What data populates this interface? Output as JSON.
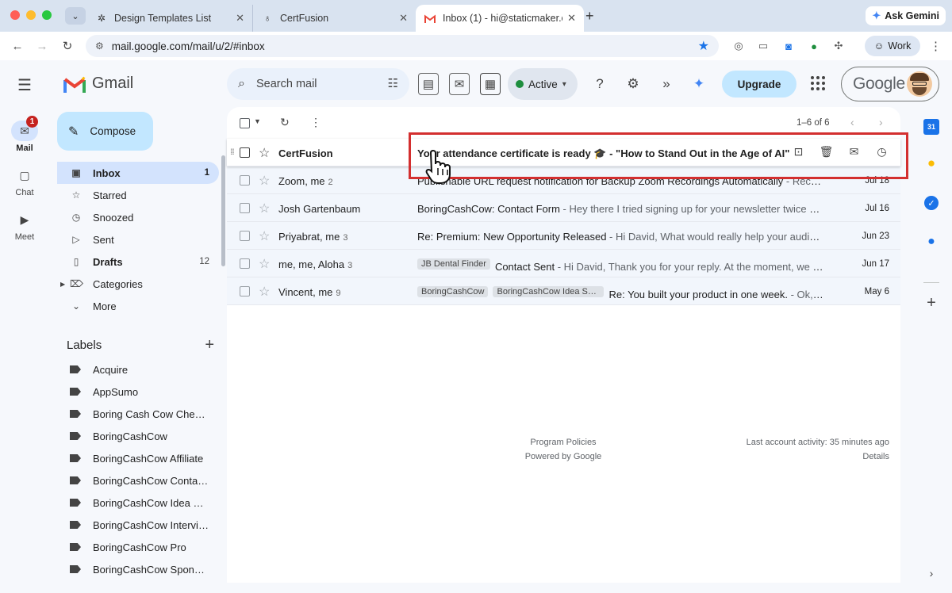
{
  "browser": {
    "tabs": [
      {
        "title": "Design Templates List",
        "icon": "openai-icon"
      },
      {
        "title": "CertFusion",
        "icon": "certfusion-icon"
      },
      {
        "title": "Inbox (1) - hi@staticmaker.co",
        "icon": "gmail-icon"
      }
    ],
    "ask_gemini": "Ask Gemini",
    "url": "mail.google.com/mail/u/2/#inbox",
    "profile": "Work"
  },
  "gmail": {
    "brand": "Gmail",
    "rail": {
      "mail": "Mail",
      "mail_badge": "1",
      "chat": "Chat",
      "meet": "Meet"
    },
    "compose": "Compose",
    "search_placeholder": "Search mail",
    "status": "Active",
    "upgrade": "Upgrade",
    "account_brand": "Google",
    "folders": [
      {
        "label": "Inbox",
        "count": "1",
        "icon": "inbox-icon"
      },
      {
        "label": "Starred",
        "count": "",
        "icon": "star-icon"
      },
      {
        "label": "Snoozed",
        "count": "",
        "icon": "clock-icon"
      },
      {
        "label": "Sent",
        "count": "",
        "icon": "send-icon"
      },
      {
        "label": "Drafts",
        "count": "12",
        "icon": "draft-icon"
      },
      {
        "label": "Categories",
        "count": "",
        "icon": "label-icon"
      },
      {
        "label": "More",
        "count": "",
        "icon": "chevron-down-icon"
      }
    ],
    "labels_heading": "Labels",
    "labels": [
      "Acquire",
      "AppSumo",
      "Boring Cash Cow Check...",
      "BoringCashCow",
      "BoringCashCow Affiliate",
      "BoringCashCow Contact...",
      "BoringCashCow Idea Su...",
      "BoringCashCow Interview",
      "BoringCashCow Pro",
      "BoringCashCow Sponso..."
    ],
    "page_count": "1–6 of 6",
    "emails": [
      {
        "sender": "CertFusion",
        "count": "",
        "chips": [],
        "subject": "Your attendance certificate is ready 🎓 - \"How to Stand Out in the Age of AI\"",
        "snippet": "",
        "date": ""
      },
      {
        "sender": "Zoom, me",
        "count": "2",
        "chips": [],
        "subject": "Publishable URL request notification for Backup Zoom Recordings Automatically",
        "snippet": " - RecordM...",
        "date": "Jul 18"
      },
      {
        "sender": "Josh Gartenbaum",
        "count": "",
        "chips": [],
        "subject": "BoringCashCow: Contact Form",
        "snippet": " - Hey there I tried signing up for your newsletter twice but I ...",
        "date": "Jul 16"
      },
      {
        "sender": "Priyabrat, me",
        "count": "3",
        "chips": [],
        "subject": "Re: Premium: New Opportunity Released",
        "snippet": " - Hi David, What would really help your audience ...",
        "date": "Jun 23"
      },
      {
        "sender": "me, me, Aloha",
        "count": "3",
        "chips": [
          "JB Dental Finder"
        ],
        "subject": "Contact Sent",
        "snippet": " - Hi David, Thank you for your reply. At the moment, we are e...",
        "date": "Jun 17"
      },
      {
        "sender": "Vincent, me",
        "count": "9",
        "chips": [
          "BoringCashCow",
          "BoringCashCow Idea Subs..."
        ],
        "subject": "Re: You built your product in one week.",
        "snippet": " - Ok, tha...",
        "date": "May 6"
      }
    ],
    "footer": {
      "policies": "Program Policies",
      "powered": "Powered by Google",
      "activity": "Last account activity: 35 minutes ago",
      "details": "Details"
    }
  },
  "sidepanel": {
    "calendar_day": "31"
  },
  "colors": {
    "accent": "#1a73e8",
    "highlight_box": "#d32f2f",
    "compose_bg": "#c2e7ff",
    "active_nav": "#d3e3fd"
  }
}
